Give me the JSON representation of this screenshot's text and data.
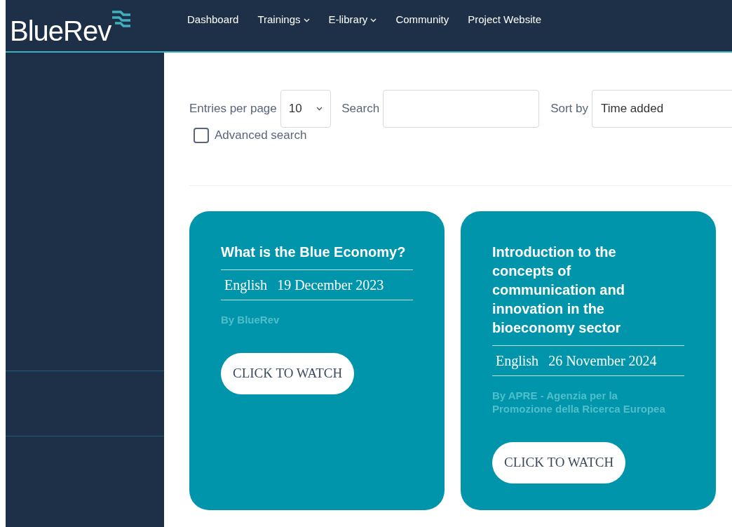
{
  "logo": {
    "text": "BlueRev"
  },
  "nav": [
    {
      "label": "Dashboard",
      "dropdown": false
    },
    {
      "label": "Trainings",
      "dropdown": true
    },
    {
      "label": "E-library",
      "dropdown": true
    },
    {
      "label": "Community",
      "dropdown": false
    },
    {
      "label": "Project Website",
      "dropdown": false
    }
  ],
  "filters": {
    "entries_label": "Entries per page",
    "entries_value": "10",
    "search_label": "Search",
    "sort_label": "Sort by",
    "sort_value": "Time added",
    "advanced_search": {
      "label": "Advanced search",
      "checked": false
    }
  },
  "cards": [
    {
      "title": "What is the Blue Economy?",
      "language": "English",
      "date": "19 December 2023",
      "author": "By BlueRev",
      "button": "CLICK TO WATCH"
    },
    {
      "title": "Introduction to the concepts of communication and innovation in the bioeconomy sector",
      "language": "English",
      "date": "26 November 2024",
      "author": "By APRE - Agenzia per la Promozione della Ricerca Europea",
      "button": "CLICK TO WATCH"
    }
  ]
}
